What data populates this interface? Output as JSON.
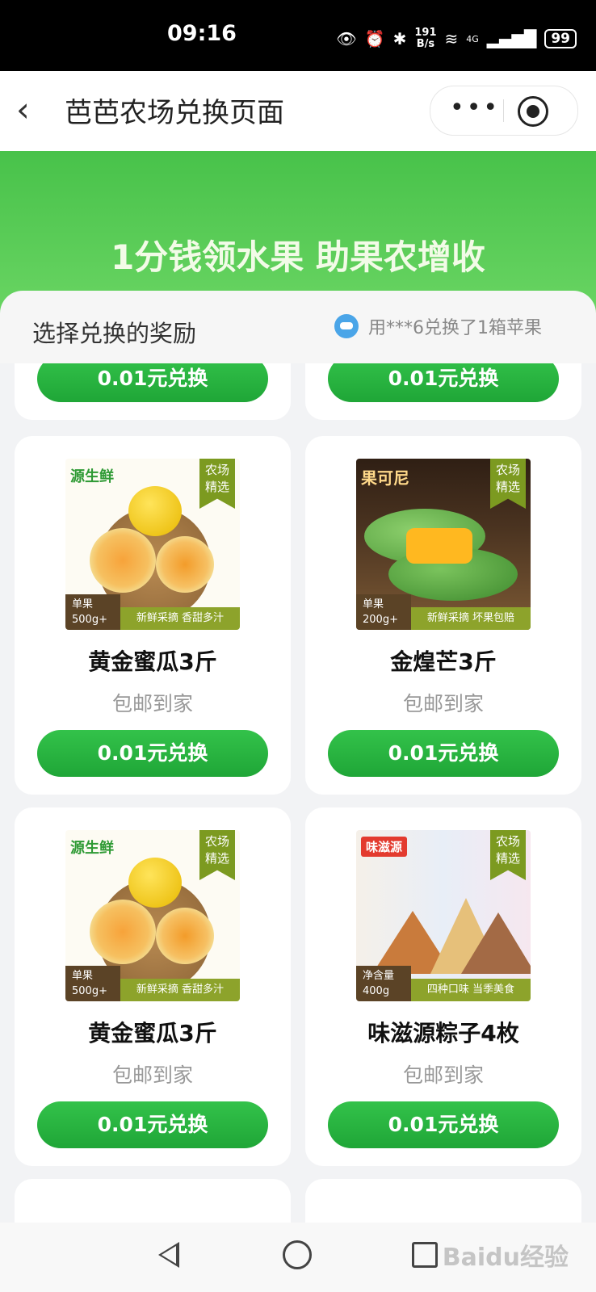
{
  "status_bar": {
    "time": "09:16",
    "speed_value": "191",
    "speed_unit": "B/s",
    "network": "4G",
    "battery": "99"
  },
  "header": {
    "title": "芭芭农场兑换页面"
  },
  "banner": {
    "title": "1分钱领水果 助果农增收"
  },
  "panel": {
    "title": "选择兑换的奖励",
    "notice": "用***6兑换了1箱苹果"
  },
  "top_buttons": [
    "0.01元兑换",
    "0.01元兑换"
  ],
  "products": [
    {
      "name": "黄金蜜瓜3斤",
      "sub": "包邮到家",
      "button": "0.01元兑换",
      "image": "melon",
      "brand": "源生鲜",
      "tag": "农场\n精选",
      "weight": "单果\n500g+",
      "slogan": "新鲜采摘 香甜多汁"
    },
    {
      "name": "金煌芒3斤",
      "sub": "包邮到家",
      "button": "0.01元兑换",
      "image": "mango",
      "brand": "果可尼",
      "tag": "农场\n精选",
      "weight": "单果\n200g+",
      "slogan": "新鲜采摘 坏果包赔"
    },
    {
      "name": "黄金蜜瓜3斤",
      "sub": "包邮到家",
      "button": "0.01元兑换",
      "image": "melon",
      "brand": "源生鲜",
      "tag": "农场\n精选",
      "weight": "单果\n500g+",
      "slogan": "新鲜采摘 香甜多汁"
    },
    {
      "name": "味滋源粽子4枚",
      "sub": "包邮到家",
      "button": "0.01元兑换",
      "image": "zongzi",
      "brand": "味滋源",
      "tag": "农场\n精选",
      "weight": "净含量\n400g",
      "slogan": "四种口味 当季美食"
    }
  ],
  "watermark": "Baidu经验",
  "icons": [
    "eye-icon",
    "alarm-icon",
    "bluetooth-icon",
    "wifi-icon",
    "signal-icon",
    "battery-icon",
    "back-arrow-icon",
    "more-dots-icon",
    "close-target-icon",
    "robot-avatar-icon",
    "nav-back-icon",
    "nav-home-icon",
    "nav-recent-icon"
  ],
  "colors": {
    "brand_green": "#2bb443",
    "banner_green": "#48c24a",
    "tag_green": "#7c9a20"
  }
}
